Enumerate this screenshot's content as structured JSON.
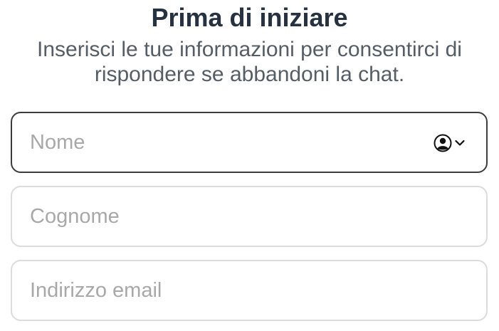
{
  "header": {
    "title": "Prima di iniziare",
    "subtitle": "Inserisci le tue informazioni per consentirci di rispondere se abbandoni la chat."
  },
  "form": {
    "first_name": {
      "placeholder": "Nome",
      "value": "",
      "focused": true,
      "autofill_icon": "contact-autofill-icon"
    },
    "last_name": {
      "placeholder": "Cognome",
      "value": ""
    },
    "email": {
      "placeholder": "Indirizzo email",
      "value": ""
    }
  },
  "colors": {
    "title": "#263241",
    "subtitle": "#555d66",
    "placeholder": "#a8a8a8",
    "border": "#dcdcdc",
    "border_focused": "#3d3d3d"
  }
}
